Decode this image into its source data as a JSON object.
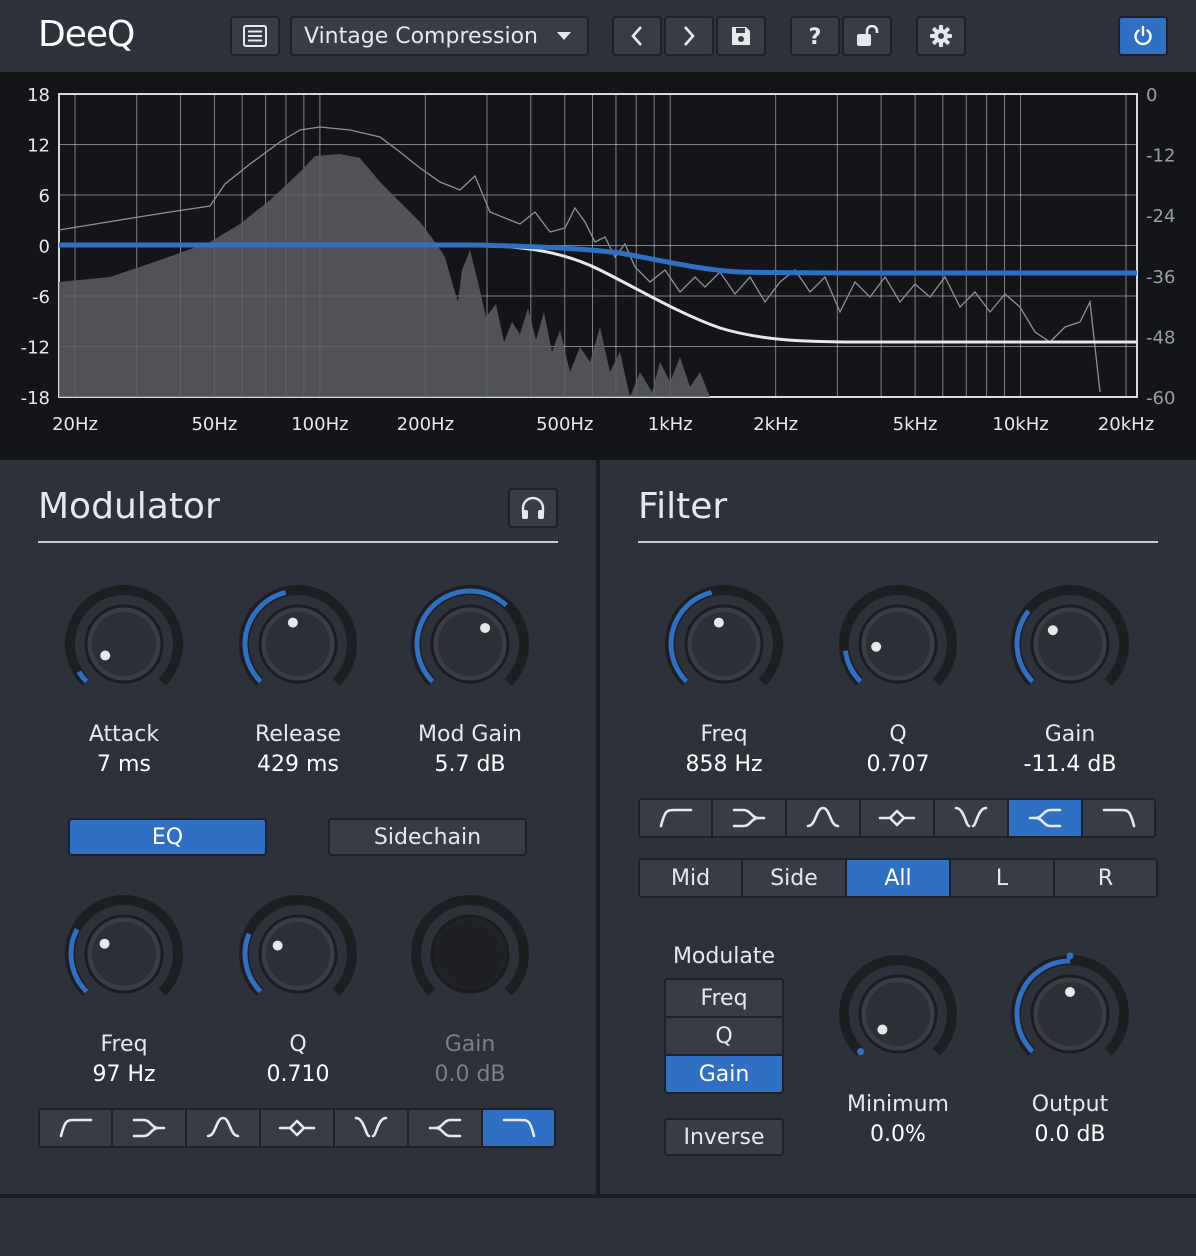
{
  "app": {
    "title": "DeeQ"
  },
  "toolbar": {
    "preset": "Vintage Compression",
    "icons": [
      "list-icon",
      "chevron-left-icon",
      "chevron-right-icon",
      "save-icon",
      "help-icon",
      "unlock-icon",
      "gear-icon",
      "power-icon"
    ]
  },
  "graph": {
    "left_axis": [
      "18",
      "12",
      "6",
      "0",
      "-6",
      "-12",
      "-18"
    ],
    "right_axis": [
      "0",
      "-12",
      "-24",
      "-36",
      "-48",
      "-60"
    ],
    "freq_labels": [
      "20Hz",
      "50Hz",
      "100Hz",
      "200Hz",
      "500Hz",
      "1kHz",
      "2kHz",
      "5kHz",
      "10kHz",
      "20kHz"
    ],
    "colors": {
      "eq_curve": "#2f6fc4",
      "filter_curve": "#e6e8ec",
      "spectrum": "#5a5d63"
    }
  },
  "modulator": {
    "title": "Modulator",
    "monitor_icon": "headphones-icon",
    "knobs": [
      {
        "label": "Attack",
        "value": "7 ms",
        "level": 0.05
      },
      {
        "label": "Release",
        "value": "429 ms",
        "level": 0.45
      },
      {
        "label": "Mod Gain",
        "value": "5.7 dB",
        "level": 0.66
      }
    ],
    "mode_buttons": {
      "eq": "EQ",
      "sidechain": "Sidechain",
      "active": "EQ"
    },
    "eq_knobs": [
      {
        "label": "Freq",
        "value": "97 Hz",
        "level": 0.27
      },
      {
        "label": "Q",
        "value": "0.710",
        "level": 0.25
      },
      {
        "label": "Gain",
        "value": "0.0 dB",
        "level": 0.5,
        "disabled": true
      }
    ],
    "filter_types": [
      "high-pass",
      "low-shelf",
      "bell",
      "notch-band",
      "band-reject",
      "high-shelf",
      "low-pass"
    ],
    "active_filter_type": 6
  },
  "filter": {
    "title": "Filter",
    "knobs": [
      {
        "label": "Freq",
        "value": "858 Hz",
        "level": 0.45
      },
      {
        "label": "Q",
        "value": "0.707",
        "level": 0.14
      },
      {
        "label": "Gain",
        "value": "-11.4 dB",
        "level": 0.31
      }
    ],
    "filter_types": [
      "high-pass",
      "low-shelf",
      "bell",
      "notch-band",
      "band-reject",
      "high-shelf",
      "low-pass"
    ],
    "active_filter_type": 5,
    "channels": [
      "Mid",
      "Side",
      "All",
      "L",
      "R"
    ],
    "active_channel": "All",
    "modulate": {
      "label": "Modulate",
      "options": [
        "Freq",
        "Q",
        "Gain"
      ],
      "active": "Gain",
      "inverse": "Inverse"
    },
    "minimum": {
      "label": "Minimum",
      "value": "0.0%",
      "level": 0.0
    },
    "output": {
      "label": "Output",
      "value": "0.0 dB",
      "level": 0.5
    }
  }
}
